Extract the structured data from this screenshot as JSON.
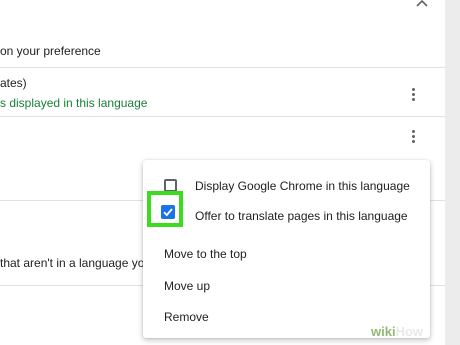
{
  "settings": {
    "preference_text": "on your preference",
    "language_name": "ates)",
    "language_status": "s displayed in this language",
    "offer_text": "that aren't in a language you r"
  },
  "menu": {
    "display_chrome_label": "Display Google Chrome in this language",
    "offer_translate_label": "Offer to translate pages in this language",
    "offer_translate_checked": true,
    "move_top_label": "Move to the top",
    "move_up_label": "Move up",
    "remove_label": "Remove"
  },
  "watermark": {
    "part1": "wiki",
    "part2": "How"
  },
  "colors": {
    "accent": "#1a73e8",
    "highlight": "#3bdc1f",
    "status_green": "#188038"
  },
  "icons": {
    "collapse": "chevron-up-icon",
    "more": "more-vert-icon",
    "check": "check-icon"
  }
}
